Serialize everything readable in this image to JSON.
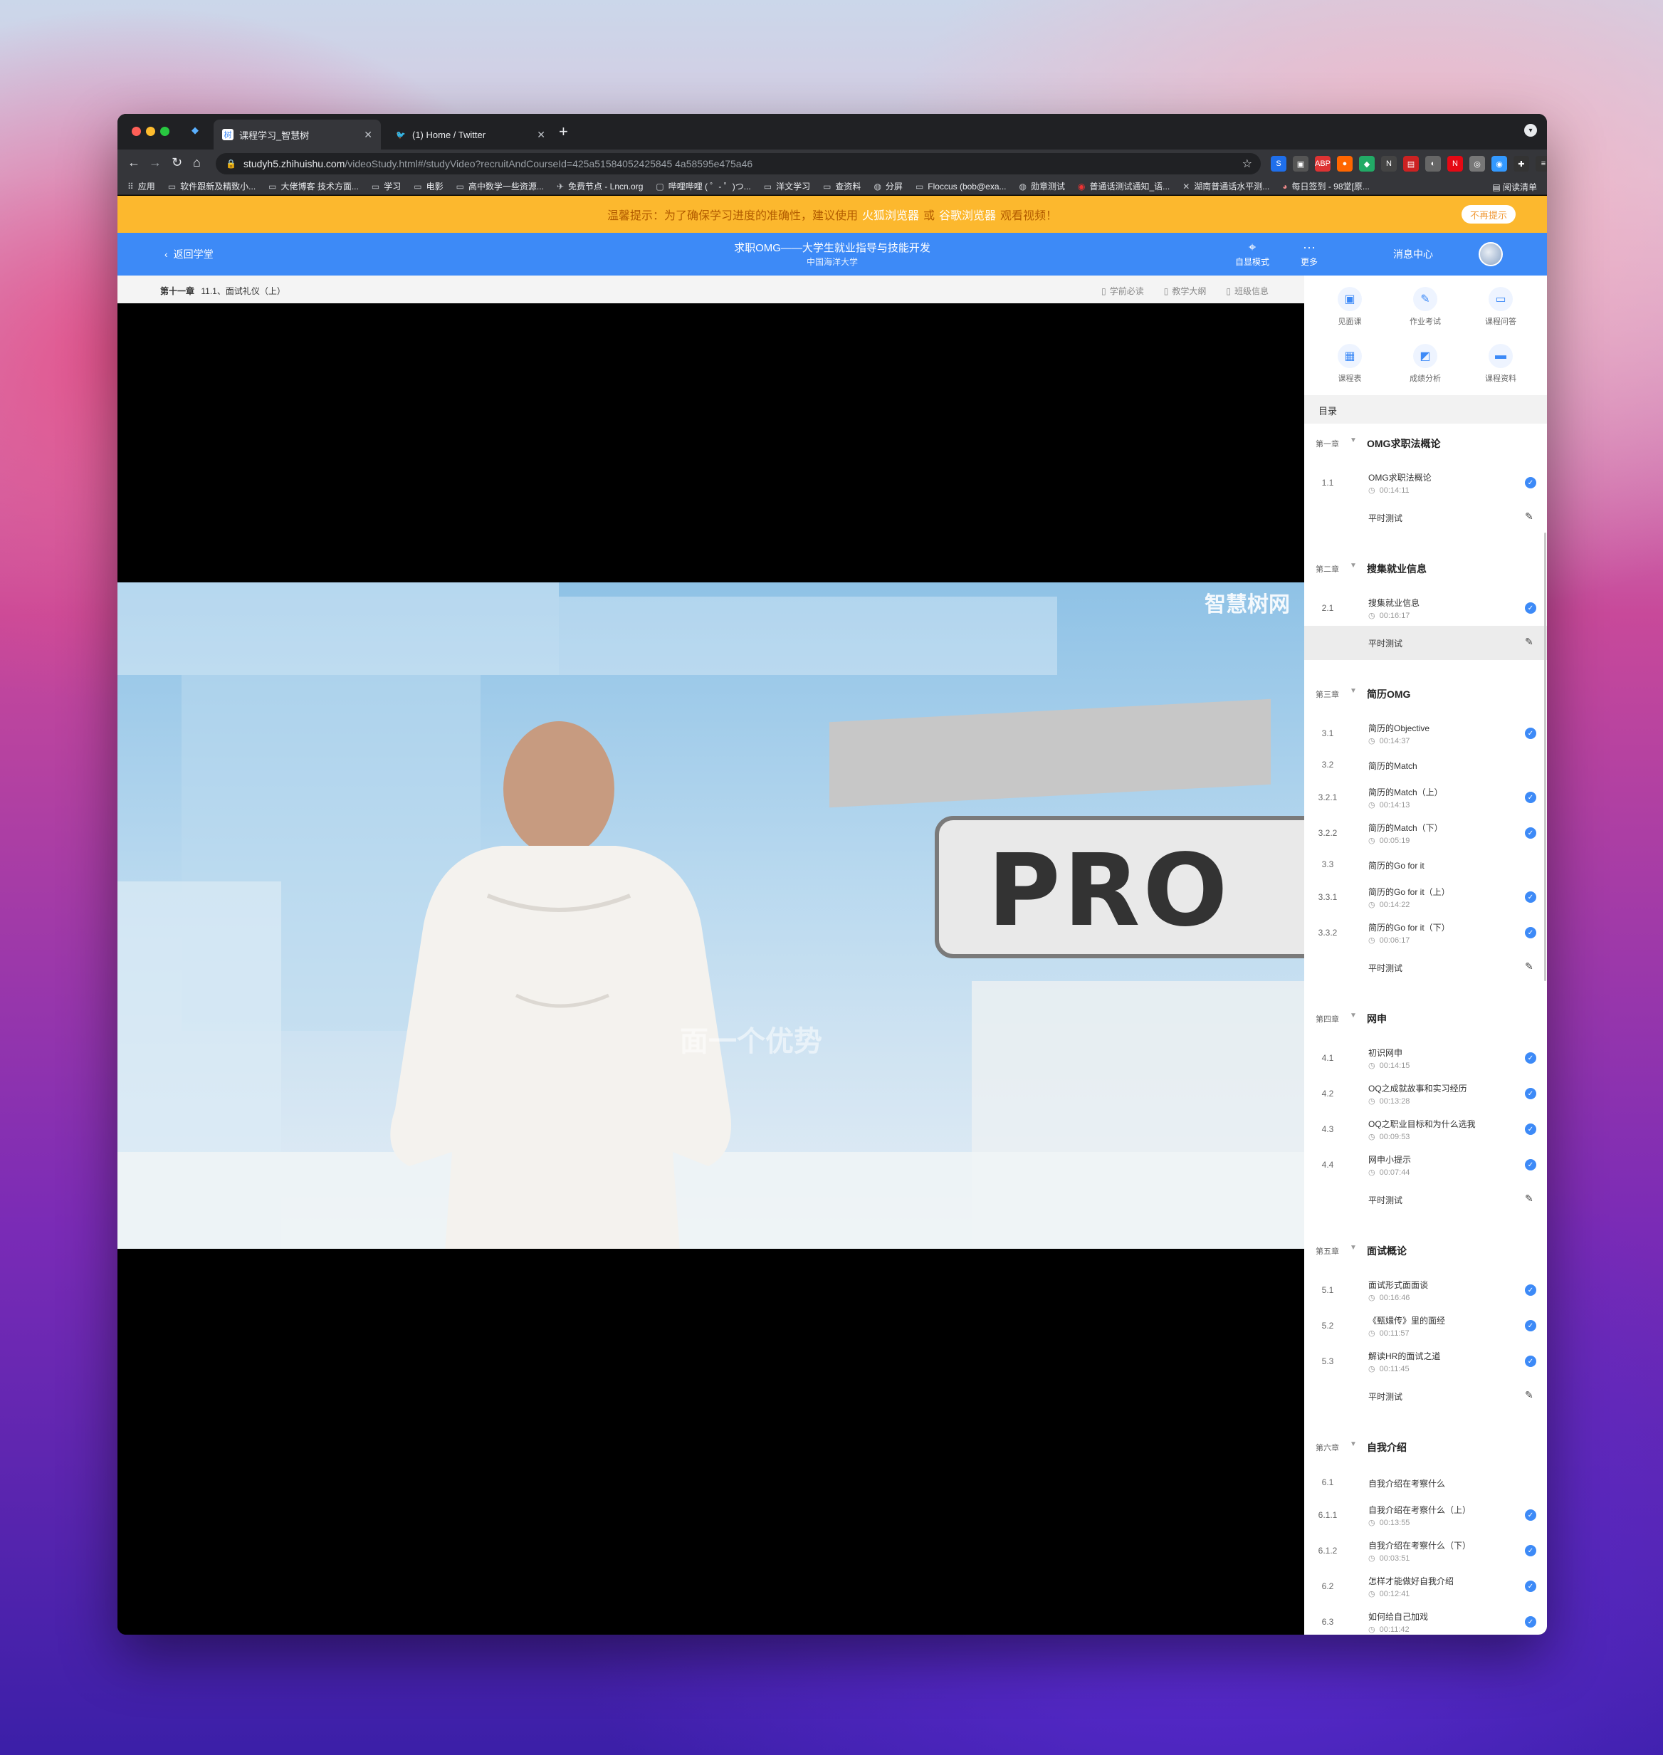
{
  "browser": {
    "tabs": [
      {
        "title": "课程学习_智慧树",
        "active": true
      },
      {
        "title": "(1) Home / Twitter",
        "active": false
      }
    ],
    "url_host": "studyh5.zhihuishu.com",
    "url_path": "/videoStudy.html#/studyVideo?recruitAndCourseId=425a51584052425845 4a58595e475a46",
    "bookmarks": [
      "应用",
      "软件跟新及精致小...",
      "大佬博客 技术方面...",
      "学习",
      "电影",
      "高中数学一些资源...",
      "免费节点 - Lncn.org",
      "哔哩哔哩 ( ゜- ゜)つ...",
      "洋文学习",
      "查资料",
      "分屏",
      "Floccus (bob@exa...",
      "勋章测试",
      "普通话测试通知_语...",
      "湖南普通话水平测...",
      "每日签到 - 98堂[原..."
    ],
    "reading_list": "阅读清单"
  },
  "notice": {
    "text_a": "温馨提示：为了确保学习进度的准确性，建议使用",
    "link1": "火狐浏览器",
    "text_b": "或",
    "link2": "谷歌浏览器",
    "text_c": "观看视频！",
    "dismiss": "不再提示"
  },
  "header": {
    "back": "返回学堂",
    "course": "求职OMG——大学生就业指导与技能开发",
    "school": "中国海洋大学",
    "focus_mode": "自显模式",
    "more": "更多",
    "messages": "消息中心"
  },
  "infobar": {
    "chapter": "第十一章",
    "lesson": "11.1、面试礼仪（上）",
    "links": [
      "学前必读",
      "教学大纲",
      "班级信息"
    ]
  },
  "video": {
    "watermark": "智慧树网",
    "sign_text": "PRO",
    "caption": "面一个优势"
  },
  "sidebar": {
    "tools": [
      "见面课",
      "作业考试",
      "课程问答",
      "课程表",
      "成绩分析",
      "课程资料"
    ],
    "toc_title": "目录",
    "chapters": [
      {
        "num": "第一章",
        "title": "OMG求职法概论",
        "lessons": [
          {
            "num": "1.1",
            "title": "OMG求职法概论",
            "dur": "00:14:11",
            "done": true
          }
        ],
        "quiz": "平时测试"
      },
      {
        "num": "第二章",
        "title": "搜集就业信息",
        "lessons": [
          {
            "num": "2.1",
            "title": "搜集就业信息",
            "dur": "00:16:17",
            "done": true
          }
        ],
        "quiz": "平时测试"
      },
      {
        "num": "第三章",
        "title": "简历OMG",
        "lessons": [
          {
            "num": "3.1",
            "title": "简历的Objective",
            "dur": "00:14:37",
            "done": true
          },
          {
            "num": "3.2",
            "title": "简历的Match",
            "dur": "",
            "done": false
          },
          {
            "num": "3.2.1",
            "title": "简历的Match（上）",
            "dur": "00:14:13",
            "done": true
          },
          {
            "num": "3.2.2",
            "title": "简历的Match（下）",
            "dur": "00:05:19",
            "done": true
          },
          {
            "num": "3.3",
            "title": "简历的Go for it",
            "dur": "",
            "done": false
          },
          {
            "num": "3.3.1",
            "title": "简历的Go for it（上）",
            "dur": "00:14:22",
            "done": true
          },
          {
            "num": "3.3.2",
            "title": "简历的Go for it（下）",
            "dur": "00:06:17",
            "done": true
          }
        ],
        "quiz": "平时测试"
      },
      {
        "num": "第四章",
        "title": "网申",
        "lessons": [
          {
            "num": "4.1",
            "title": "初识网申",
            "dur": "00:14:15",
            "done": true
          },
          {
            "num": "4.2",
            "title": "OQ之成就故事和实习经历",
            "dur": "00:13:28",
            "done": true
          },
          {
            "num": "4.3",
            "title": "OQ之职业目标和为什么选我",
            "dur": "00:09:53",
            "done": true
          },
          {
            "num": "4.4",
            "title": "网申小提示",
            "dur": "00:07:44",
            "done": true
          }
        ],
        "quiz": "平时测试"
      },
      {
        "num": "第五章",
        "title": "面试概论",
        "lessons": [
          {
            "num": "5.1",
            "title": "面试形式面面谈",
            "dur": "00:16:46",
            "done": true
          },
          {
            "num": "5.2",
            "title": "《甄嬛传》里的面经",
            "dur": "00:11:57",
            "done": true
          },
          {
            "num": "5.3",
            "title": "解读HR的面试之道",
            "dur": "00:11:45",
            "done": true
          }
        ],
        "quiz": "平时测试"
      },
      {
        "num": "第六章",
        "title": "自我介绍",
        "lessons": [
          {
            "num": "6.1",
            "title": "自我介绍在考察什么",
            "dur": "",
            "done": false
          },
          {
            "num": "6.1.1",
            "title": "自我介绍在考察什么（上）",
            "dur": "00:13:55",
            "done": true
          },
          {
            "num": "6.1.2",
            "title": "自我介绍在考察什么（下）",
            "dur": "00:03:51",
            "done": true
          },
          {
            "num": "6.2",
            "title": "怎样才能做好自我介绍",
            "dur": "00:12:41",
            "done": true
          },
          {
            "num": "6.3",
            "title": "如何给自己加戏",
            "dur": "00:11:42",
            "done": true
          }
        ],
        "quiz": ""
      }
    ]
  },
  "colors": {
    "brand_blue": "#3d8af7",
    "notice_yellow": "#fcb82e",
    "done_check": "#3d8af7"
  }
}
